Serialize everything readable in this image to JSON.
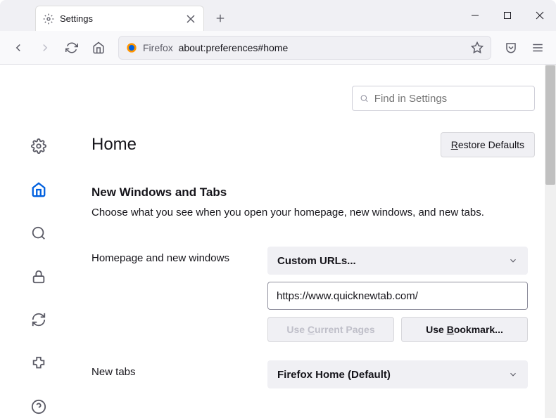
{
  "window": {
    "tab_title": "Settings"
  },
  "urlbar": {
    "identity_label": "Firefox",
    "url": "about:preferences#home"
  },
  "search": {
    "placeholder": "Find in Settings"
  },
  "page": {
    "title": "Home",
    "restore_button": "Restore Defaults",
    "section_heading": "New Windows and Tabs",
    "section_desc": "Choose what you see when you open your homepage, new windows, and new tabs."
  },
  "homepage": {
    "label": "Homepage and new windows",
    "select_value": "Custom URLs...",
    "url_value": "https://www.quicknewtab.com/",
    "use_current": "Use Current Pages",
    "use_bookmark": "Use Bookmark..."
  },
  "newtabs": {
    "label": "New tabs",
    "select_value": "Firefox Home (Default)"
  },
  "sidebar": {
    "items": [
      "general",
      "home",
      "search",
      "privacy",
      "sync",
      "extensions",
      "help"
    ]
  }
}
